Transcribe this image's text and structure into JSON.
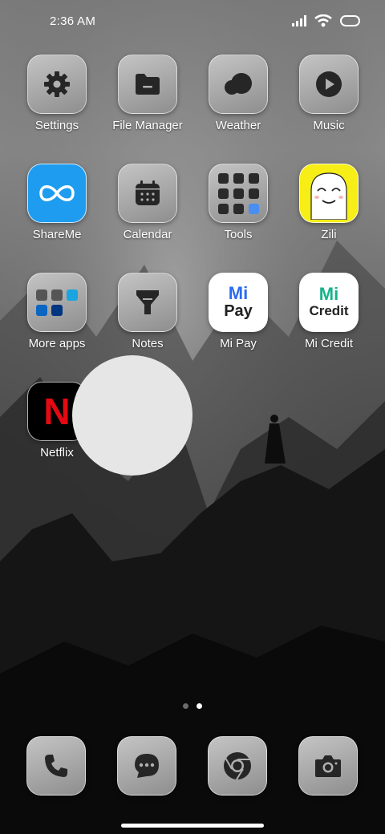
{
  "status_bar": {
    "time": "2:36 AM"
  },
  "apps": {
    "settings": "Settings",
    "file_manager": "File Manager",
    "weather": "Weather",
    "music": "Music",
    "shareme": "ShareMe",
    "calendar": "Calendar",
    "tools": "Tools",
    "zili": "Zili",
    "more_apps": "More apps",
    "notes": "Notes",
    "mi_pay": "Mi Pay",
    "mi_credit": "Mi Credit",
    "netflix": "Netflix"
  },
  "icon_text": {
    "mi_pay_top": "Mi",
    "mi_pay_bottom": "Pay",
    "mi_credit_top": "Mi",
    "mi_credit_bottom": "Credit",
    "netflix_logo": "N"
  },
  "page_indicator": {
    "pages": 2,
    "active_page": 2
  },
  "dock": [
    "phone-icon",
    "messages-icon",
    "chrome-icon",
    "camera-icon"
  ],
  "colors": {
    "shareme_bg": "#1e9cf0",
    "zili_bg": "#f6ee16",
    "mi_green": "#16b38a",
    "mi_blue": "#2a6cf0",
    "netflix_red": "#e50914"
  }
}
